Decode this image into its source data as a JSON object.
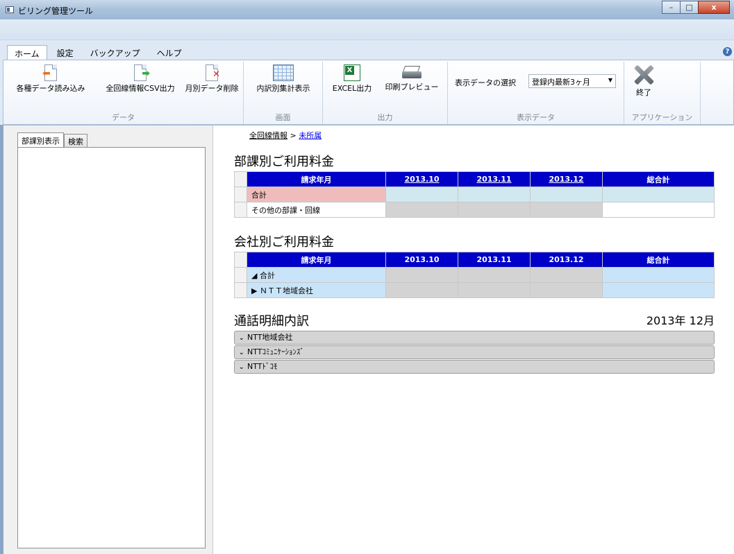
{
  "window": {
    "title": "ビリング管理ツール",
    "minimize": "–",
    "maximize": "□",
    "close": "x"
  },
  "ribbon": {
    "tabs": [
      "ホーム",
      "設定",
      "バックアップ",
      "ヘルプ"
    ],
    "help": "?",
    "groups": {
      "data": {
        "label": "データ",
        "buttons": [
          "各種データ読み込み",
          "全回線情報CSV出力",
          "月別データ削除"
        ]
      },
      "screen": {
        "label": "画面",
        "buttons": [
          "内訳別集計表示"
        ]
      },
      "output": {
        "label": "出力",
        "buttons": [
          "EXCEL出力",
          "印刷プレビュー"
        ]
      },
      "display": {
        "label": "表示データ",
        "select_label": "表示データの選択",
        "select_value": "登録内最新3ヶ月"
      },
      "app": {
        "label": "アプリケーション",
        "buttons": [
          "終了"
        ]
      }
    }
  },
  "left": {
    "tabs": [
      "部課別表示",
      "検索"
    ]
  },
  "breadcrumb": {
    "root": "全回線情報",
    "sep": ">",
    "current": "未所属"
  },
  "dept_section": {
    "title": "部課別ご利用料金",
    "header": [
      "請求年月",
      "2013.10",
      "2013.11",
      "2013.12",
      "総合計"
    ],
    "rows": [
      "合計",
      "その他の部課・回線"
    ]
  },
  "company_section": {
    "title": "会社別ご利用料金",
    "header": [
      "請求年月",
      "2013.10",
      "2013.11",
      "2013.12",
      "総合計"
    ],
    "rows": [
      "◢ 合計",
      "▶ ＮＴＴ地域会社"
    ]
  },
  "detail_section": {
    "title": "通話明細内訳",
    "month": "2013年 12月",
    "groups": [
      "NTT地域会社",
      "NTTｺﾐｭﾆｹｰｼｮﾝｽﾞ",
      "NTTﾄﾞｺﾓ"
    ]
  },
  "colors": {
    "header_blue": "#0000c8",
    "pink": "#efbcbc",
    "light_blue": "#d1e8f0",
    "grey": "#d3d3d3"
  }
}
